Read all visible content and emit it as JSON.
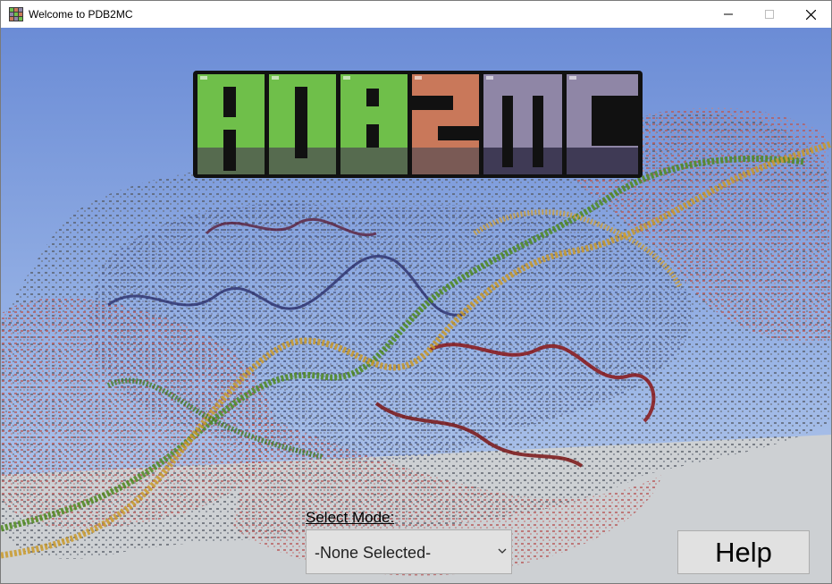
{
  "window": {
    "title": "Welcome to PDB2MC",
    "icons": {
      "app": "grid-app-icon",
      "minimize": "minimize-icon",
      "maximize": "maximize-icon",
      "close": "close-icon"
    }
  },
  "logo": {
    "text": "PDB2MC",
    "colors": {
      "green": "#6fbf4a",
      "orange": "#c9785a",
      "purple": "#8f86a6",
      "outline": "#111111"
    }
  },
  "background": {
    "sky_top": "#6e8fd8",
    "sky_bottom": "#a9c2ea",
    "ground": "#cfd2d4"
  },
  "mode_select": {
    "label": "Select Mode:",
    "value": "-None Selected-"
  },
  "help_button": {
    "label": "Help"
  }
}
